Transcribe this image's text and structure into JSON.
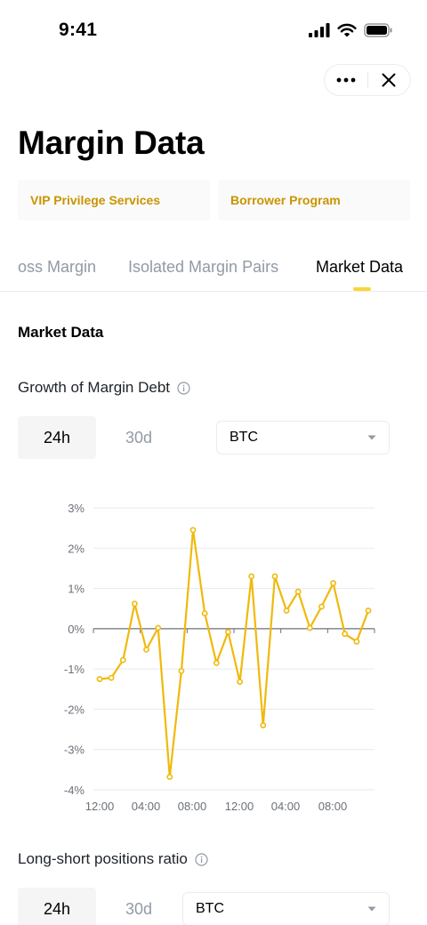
{
  "status_bar": {
    "time": "9:41"
  },
  "page_title": "Margin Data",
  "promos": [
    "VIP Privilege Services",
    "Borrower Program"
  ],
  "tabs": [
    {
      "label": "oss Margin"
    },
    {
      "label": "Isolated Margin Pairs"
    },
    {
      "label": "Market Data"
    }
  ],
  "section_title": "Market Data",
  "growth": {
    "title": "Growth of Margin Debt",
    "period_24h": "24h",
    "period_30d": "30d",
    "coin": "BTC"
  },
  "long_short": {
    "title": "Long-short positions ratio",
    "period_24h": "24h",
    "period_30d": "30d",
    "coin": "BTC"
  },
  "colors": {
    "accent": "#fcd535",
    "line": "#f0b90b",
    "promo_text": "#c99400",
    "muted": "#929aa5"
  },
  "chart_data": {
    "type": "line",
    "y_ticks": [
      "3%",
      "2%",
      "1%",
      "0%",
      "-1%",
      "-2%",
      "-3%",
      "-4%"
    ],
    "x_ticks": [
      "12:00",
      "04:00",
      "08:00",
      "12:00",
      "04:00",
      "08:00"
    ],
    "ylim": [
      -4,
      3
    ],
    "series": [
      {
        "values": [
          -1.25,
          -1.22,
          -0.78,
          0.62,
          -0.52,
          0.02,
          -3.68,
          -1.05,
          2.45,
          0.38,
          -0.85,
          -0.08,
          -1.32,
          1.3,
          -2.4,
          1.3,
          0.45,
          0.92,
          0.02,
          0.55,
          1.13,
          -0.13,
          -0.32,
          0.45
        ]
      }
    ]
  }
}
